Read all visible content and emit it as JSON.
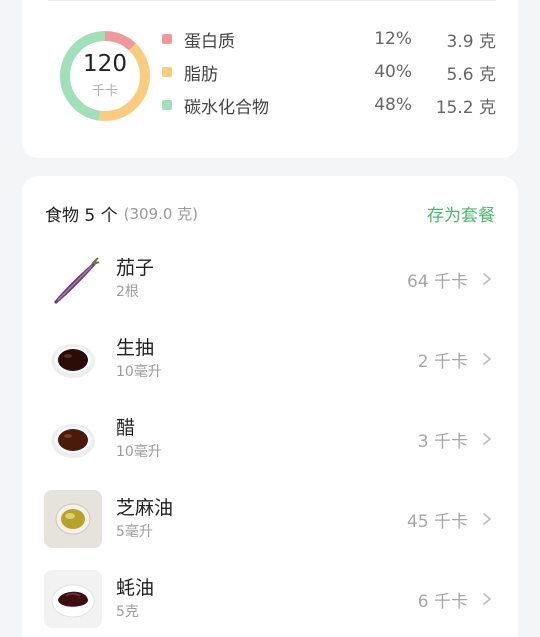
{
  "nutrition": {
    "total_calories": "120",
    "calorie_unit": "千卡",
    "colors": {
      "protein": "#ef9a9a",
      "fat": "#f9cd7d",
      "carb": "#9fe0b8"
    },
    "macros": [
      {
        "key": "protein",
        "name": "蛋白质",
        "pct": "12%",
        "amount": "3.9 克",
        "fraction": 0.12
      },
      {
        "key": "fat",
        "name": "脂肪",
        "pct": "40%",
        "amount": "5.6 克",
        "fraction": 0.4
      },
      {
        "key": "carb",
        "name": "碳水化合物",
        "pct": "48%",
        "amount": "15.2 克",
        "fraction": 0.48
      }
    ]
  },
  "food_list": {
    "title": "食物 5 个",
    "total_weight": "(309.0 克)",
    "save_label": "存为套餐",
    "items": [
      {
        "name": "茄子",
        "qty": "2根",
        "kcal": "64 千卡",
        "icon": "eggplant-icon"
      },
      {
        "name": "生抽",
        "qty": "10毫升",
        "kcal": "2 千卡",
        "icon": "soy-sauce-icon"
      },
      {
        "name": "醋",
        "qty": "10毫升",
        "kcal": "3 千卡",
        "icon": "vinegar-icon"
      },
      {
        "name": "芝麻油",
        "qty": "5毫升",
        "kcal": "45 千卡",
        "icon": "sesame-oil-icon"
      },
      {
        "name": "蚝油",
        "qty": "5克",
        "kcal": "6 千卡",
        "icon": "oyster-sauce-icon"
      }
    ]
  }
}
